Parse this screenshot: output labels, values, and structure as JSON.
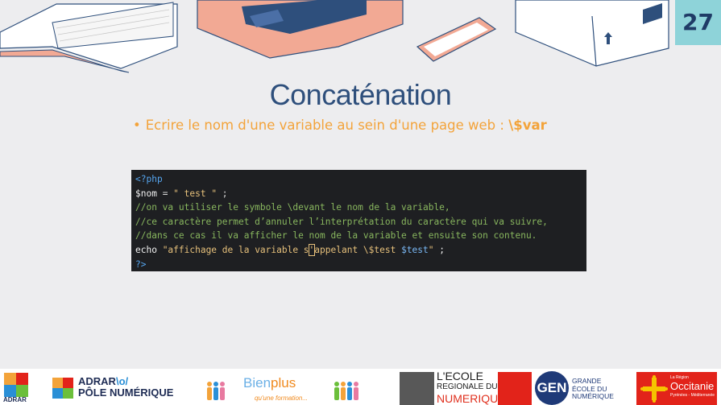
{
  "page_number": "27",
  "title": "Concaténation",
  "bullet": {
    "marker": "•",
    "text": "Ecrire le nom d'une variable au sein d'une page web : ",
    "code": "\\$var"
  },
  "code": {
    "open_tag": "<?php",
    "line2": {
      "var": "$nom",
      "eq": " = ",
      "str": "\" test \"",
      "end": " ;"
    },
    "comment1": "//on va utiliser le symbole \\devant le nom de la variable,",
    "comment2": "//ce caractère permet d’annuler l’interprétation du caractère qui va suivre,",
    "comment3": "//dans ce cas il va afficher le nom de la variable et ensuite son contenu.",
    "line6": {
      "kw": "echo ",
      "str_a": "\"affichage de la variable s",
      "cursor": "'",
      "str_b": "appelant \\$test ",
      "strvar": "$test",
      "str_c": "\"",
      "end": " ;"
    },
    "close_tag": "?>"
  },
  "footer": {
    "adrar_small": "ADRAR",
    "pole_line1_a": "ADRAR",
    "pole_line1_b": "\\o/",
    "pole_line2": "PÔLE NUMÉRIQUE",
    "bien_a": "Bien",
    "bien_b": "plus",
    "bien_sub": "qu'une formation...",
    "ecole_l1": "L'ECOLE",
    "ecole_l2": "REGIONALE DU",
    "ecole_l3": "NUMERIQUE",
    "gen": "GEN",
    "gen_l1": "GRANDE",
    "gen_l2": "ÉCOLE DU",
    "gen_l3": "NUMÉRIQUE",
    "occ_small": "La Région",
    "occ_big": "Occitanie",
    "occ_sub": "Pyrénées - Méditerranée"
  },
  "colors": {
    "title": "#2e4f7c",
    "bullet": "#f3a33a",
    "code_bg": "#1e1f22",
    "page_badge": "#8ed3d9"
  }
}
